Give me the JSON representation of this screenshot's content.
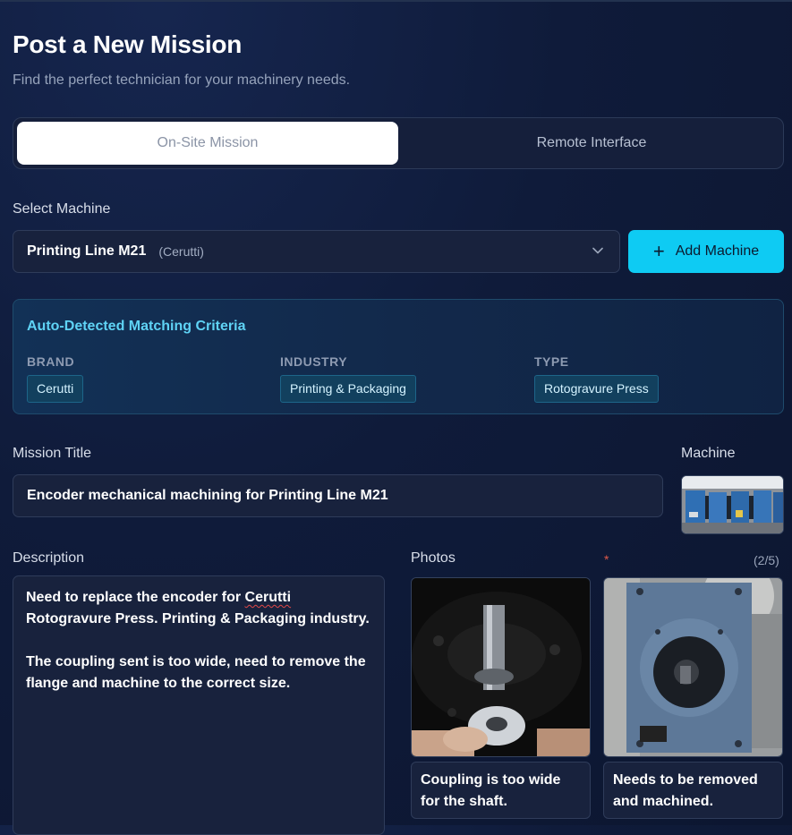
{
  "page": {
    "title": "Post a New Mission",
    "subtitle": "Find the perfect technician for your machinery needs."
  },
  "tabs": [
    {
      "label": "On-Site Mission",
      "active": true
    },
    {
      "label": "Remote Interface",
      "active": false
    }
  ],
  "machine_select": {
    "label": "Select Machine",
    "value": "Printing Line M21",
    "brand_hint": "(Cerutti)",
    "add_button_label": "Add Machine"
  },
  "criteria": {
    "title": "Auto-Detected Matching Criteria",
    "brand": {
      "heading": "BRAND",
      "value": "Cerutti"
    },
    "industry": {
      "heading": "INDUSTRY",
      "value": "Printing & Packaging"
    },
    "type": {
      "heading": "TYPE",
      "value": "Rotogravure Press"
    }
  },
  "mission": {
    "title_label": "Mission Title",
    "title_value": "Encoder mechanical machining for Printing Line M21",
    "machine_label": "Machine"
  },
  "description": {
    "label": "Description",
    "line1_pre": "Need to replace the encoder for ",
    "line1_flag": "Cerutti",
    "line1_post": " Rotogravure Press. Printing & Packaging industry.",
    "paragraph2": "The coupling sent is too wide, need to remove the flange and machine to the correct size."
  },
  "photos": {
    "label": "Photos",
    "required_mark": "*",
    "count": "(2/5)",
    "items": [
      {
        "caption": "Coupling is too wide for the shaft."
      },
      {
        "caption": "Needs to be removed and machined."
      }
    ]
  },
  "colors": {
    "accent": "#0ecbf3",
    "criteria_title": "#5fd3f5",
    "background": "#0f1b3a"
  }
}
